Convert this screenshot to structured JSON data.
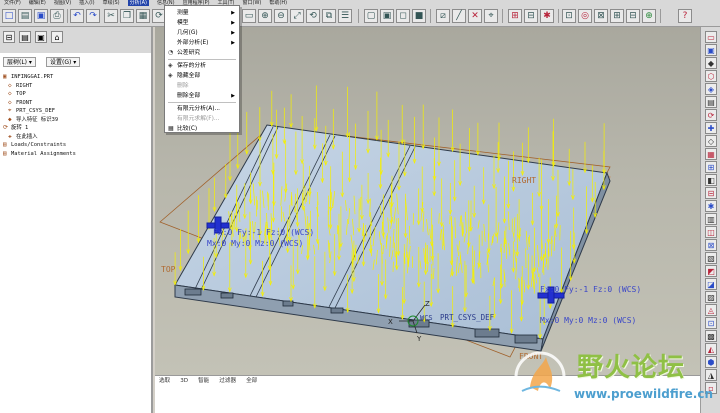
{
  "menubar": {
    "items": [
      "文件(F)",
      "编辑(E)",
      "视图(V)",
      "插入(I)",
      "草绘(S)",
      "分析(A)",
      "信息(N)",
      "应用程序(P)",
      "工具(T)",
      "窗口(W)",
      "帮助(H)"
    ],
    "active_index": 5
  },
  "left_panel": {
    "layer_dropdown": "层树(L) ▾",
    "settings_dropdown": "设置(G) ▾",
    "tree": [
      {
        "label": "INFINGGAI.PRT",
        "icon": "part-icon",
        "level": 0
      },
      {
        "label": "RIGHT",
        "icon": "datum-plane-icon",
        "level": 1
      },
      {
        "label": "TOP",
        "icon": "datum-plane-icon",
        "level": 1
      },
      {
        "label": "FRONT",
        "icon": "datum-plane-icon",
        "level": 1
      },
      {
        "label": "PRT_CSYS_DEF",
        "icon": "csys-icon",
        "level": 1
      },
      {
        "label": "导入特征 标识39",
        "icon": "import-feature-icon",
        "level": 1
      },
      {
        "label": "旋转 1",
        "icon": "revolve-icon",
        "level": 0
      },
      {
        "label": "在此插入",
        "icon": "insert-here-icon",
        "level": 1
      },
      {
        "label": "Loads/Constraints",
        "icon": "folder-icon",
        "level": 0
      },
      {
        "label": "Material Assignments",
        "icon": "folder-icon",
        "level": 0
      }
    ]
  },
  "dropdown": {
    "items": [
      {
        "label": "测量",
        "submenu": true,
        "enabled": true
      },
      {
        "label": "模型",
        "submenu": true,
        "enabled": true
      },
      {
        "label": "几何(G)",
        "submenu": true,
        "enabled": true
      },
      {
        "label": "外部分析(E)",
        "submenu": true,
        "enabled": true
      },
      {
        "label": "公差研究",
        "submenu": false,
        "enabled": true
      },
      {
        "label": "保存的分析",
        "submenu": false,
        "enabled": true
      },
      {
        "label": "隐藏全部",
        "submenu": false,
        "enabled": true
      },
      {
        "label": "删除",
        "submenu": false,
        "enabled": false
      },
      {
        "label": "删除全部",
        "submenu": true,
        "enabled": true
      },
      {
        "label": "有限元分析(A)...",
        "submenu": false,
        "enabled": true
      },
      {
        "label": "有限元求解(F)...",
        "submenu": false,
        "enabled": false
      },
      {
        "label": "比较(C)",
        "submenu": false,
        "enabled": true
      }
    ]
  },
  "viewport_labels": {
    "right": "RIGHT",
    "top": "TOP",
    "front": "FRONT",
    "csys": "PRT_CSYS_DEF",
    "wcs": "WCS",
    "axis_x": "X",
    "axis_y": "Y",
    "axis_z": "Z",
    "load_left_1": "Fx:0 Fy:-1 Fz:0 (WCS)",
    "load_left_2": "Mx:0 My:0 Mz:0 (WCS)",
    "load_right_1": "Fx:0 Fy:-1 Fz:0 (WCS)",
    "load_right_2": "Mx:0 My:0 Mz:0 (WCS)"
  },
  "status_bar": {
    "items": [
      "选取",
      "3D",
      "智能",
      "过滤器",
      "全部"
    ]
  },
  "watermark": {
    "title": "野火论坛",
    "url": "www.proewildfire.cn"
  },
  "colors": {
    "viewport_bg": "#b8b7ac",
    "plate_fill": "#b9cce0",
    "load_arrows": "#f5f000",
    "constraint_blue": "#2230d0",
    "model_edge": "#2e3a4a"
  }
}
